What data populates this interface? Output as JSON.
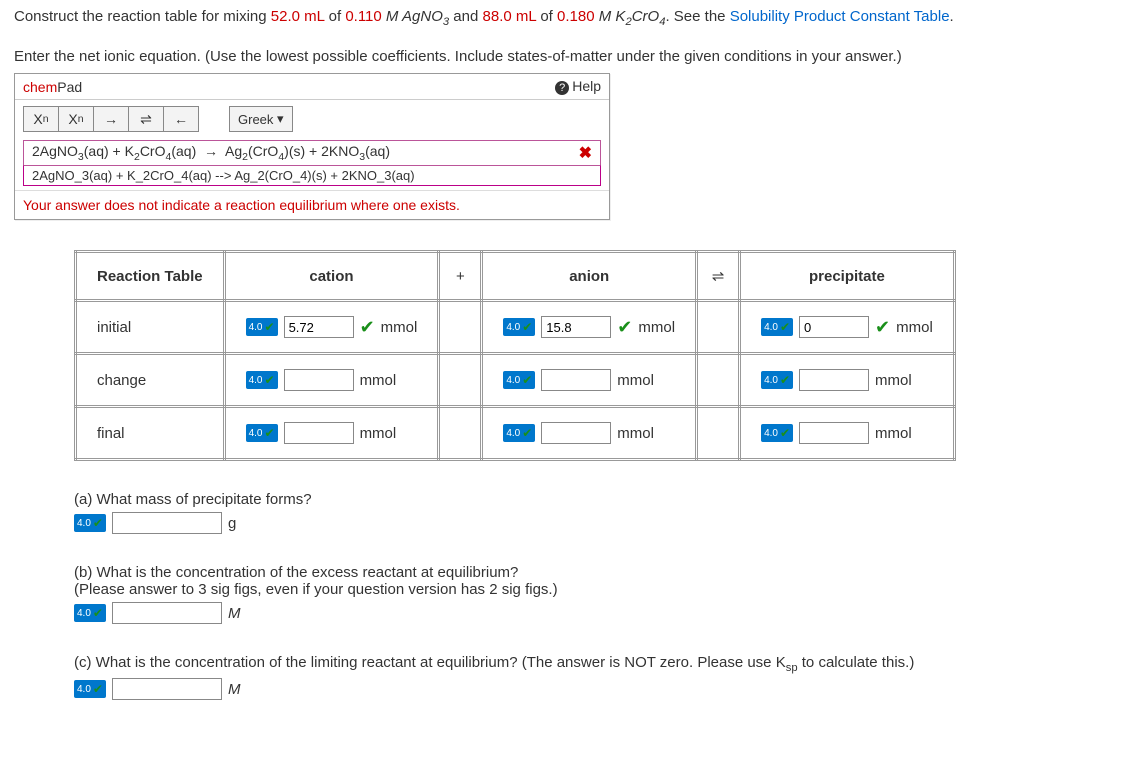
{
  "problem": {
    "prefix": "Construct the reaction table for mixing ",
    "vol1": "52.0 mL",
    "of1": " of ",
    "conc1": "0.110 ",
    "reagent1_html": "M AgNO<sub>3</sub>",
    "and": " and ",
    "vol2": "88.0 mL",
    "of2": " of ",
    "conc2": "0.180 ",
    "reagent2_html": "M K<sub>2</sub>CrO<sub>4</sub>",
    "suffix": ". See the ",
    "link": "Solubility Product Constant Table",
    "period": "."
  },
  "instructions": "Enter the net ionic equation. (Use the lowest possible coefficients. Include states-of-matter under the given conditions in your answer.)",
  "chemPad": {
    "brand1": "chem",
    "brand2": "Pad",
    "help": "Help",
    "tools": {
      "subscript": "X",
      "subscript_n": "n",
      "superscript": "X",
      "superscript_n": "n",
      "arrow": "→",
      "equilibrium": "⇌",
      "back": "←"
    },
    "greek": "Greek",
    "rendered": "2AgNO<sub>3</sub>(aq) + K<sub>2</sub>CrO<sub>4</sub>(aq)  →  Ag<sub>2</sub>(CrO<sub>4</sub>)(s) + 2KNO<sub>3</sub>(aq)",
    "raw": "2AgNO_3(aq) + K_2CrO_4(aq) --> Ag_2(CrO_4)(s) + 2KNO_3(aq)",
    "feedback": "Your answer does not indicate a reaction equilibrium where one exists."
  },
  "table": {
    "header": {
      "title": "Reaction Table",
      "cation": "cation",
      "plus": "+",
      "anion": "anion",
      "equil": "⇌",
      "precip": "precipitate"
    },
    "rows": [
      {
        "label": "initial",
        "cation": {
          "points": "4.0",
          "value": "5.72",
          "check": true,
          "unit": "mmol"
        },
        "anion": {
          "points": "4.0",
          "value": "15.8",
          "check": true,
          "unit": "mmol"
        },
        "precip": {
          "points": "4.0",
          "value": "0",
          "check": true,
          "unit": "mmol"
        }
      },
      {
        "label": "change",
        "cation": {
          "points": "4.0",
          "value": "",
          "check": false,
          "unit": "mmol"
        },
        "anion": {
          "points": "4.0",
          "value": "",
          "check": false,
          "unit": "mmol"
        },
        "precip": {
          "points": "4.0",
          "value": "",
          "check": false,
          "unit": "mmol"
        }
      },
      {
        "label": "final",
        "cation": {
          "points": "4.0",
          "value": "",
          "check": false,
          "unit": "mmol"
        },
        "anion": {
          "points": "4.0",
          "value": "",
          "check": false,
          "unit": "mmol"
        },
        "precip": {
          "points": "4.0",
          "value": "",
          "check": false,
          "unit": "mmol"
        }
      }
    ]
  },
  "qa": {
    "a": {
      "prompt": "(a) What mass of precipitate forms?",
      "points": "4.0",
      "unit": "g"
    },
    "b": {
      "prompt": "(b) What is the concentration of the excess reactant at equilibrium?",
      "note": "(Please answer to 3 sig figs, even if your question version has 2 sig figs.)",
      "points": "4.0",
      "unit": "M"
    },
    "c": {
      "prompt_pre": "(c) What is the concentration of the limiting reactant at equilibrium? (The answer is NOT zero. Please use K",
      "prompt_sub": "sp",
      "prompt_post": " to calculate this.)",
      "points": "4.0",
      "unit": "M"
    }
  }
}
